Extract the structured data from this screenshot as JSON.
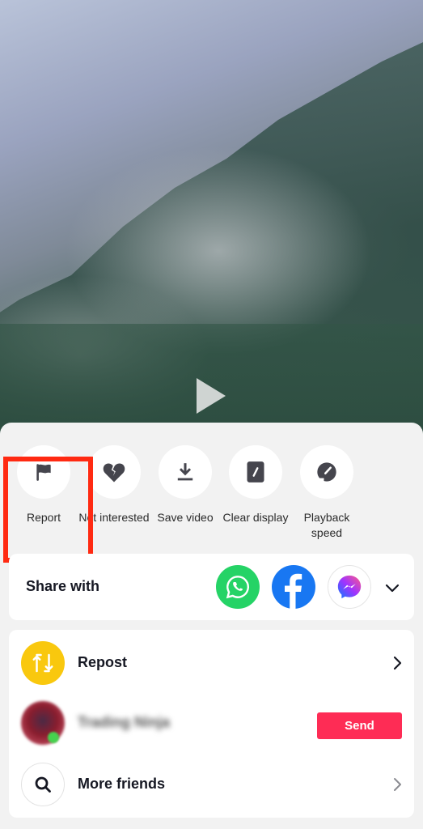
{
  "video": {
    "state": "paused",
    "play_icon": "play-icon"
  },
  "actions": [
    {
      "label": "Report",
      "icon": "flag-icon",
      "highlighted": true
    },
    {
      "label": "Not interested",
      "icon": "broken-heart-icon"
    },
    {
      "label": "Save video",
      "icon": "download-icon"
    },
    {
      "label": "Clear display",
      "icon": "clear-display-icon"
    },
    {
      "label": "Playback speed",
      "icon": "speedometer-icon"
    }
  ],
  "share": {
    "title": "Share with",
    "apps": [
      {
        "name": "WhatsApp",
        "icon": "whatsapp-icon",
        "color": "#25d366"
      },
      {
        "name": "Facebook",
        "icon": "facebook-icon",
        "color": "#1877f2"
      },
      {
        "name": "Messenger",
        "icon": "messenger-icon",
        "color": "#a033ff"
      }
    ],
    "more_icon": "chevron-down-icon"
  },
  "list": {
    "repost": {
      "label": "Repost",
      "icon": "repost-icon",
      "color": "#f9c80e"
    },
    "friend": {
      "name": "Trading Ninja",
      "blurred": true,
      "online": true,
      "button_label": "Send",
      "button_color": "#fe2c55"
    },
    "more_friends": {
      "label": "More friends",
      "icon": "search-icon"
    }
  },
  "highlight_color": "#ff2a12"
}
